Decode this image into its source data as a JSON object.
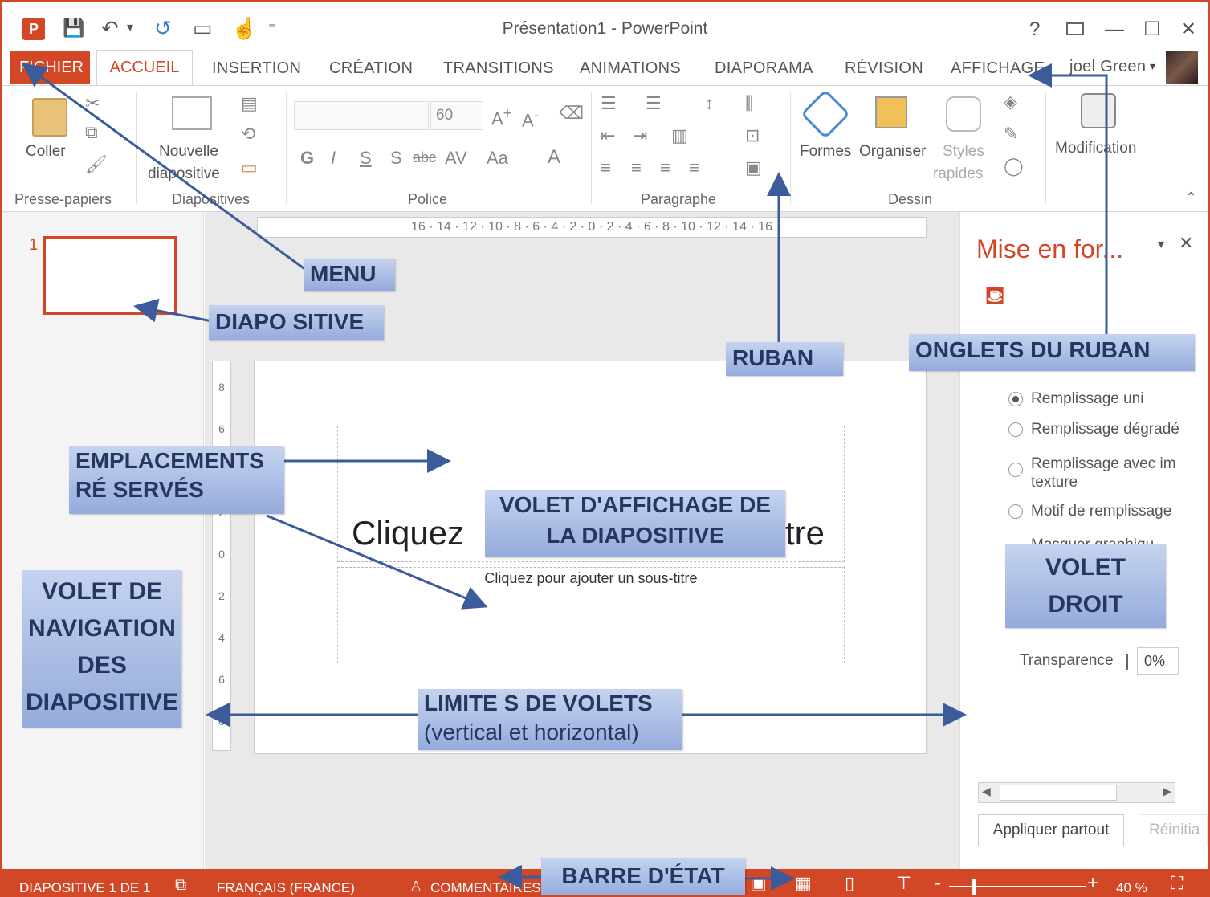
{
  "window": {
    "title": "Présentation1 - PowerPoint",
    "user": "joel Green",
    "help": "?",
    "restore_icon": "ribbon-display-icon",
    "min": "—",
    "max": "☐",
    "close": "✕"
  },
  "qat": {
    "app_icon": "P",
    "save": "💾",
    "undo": "↶",
    "undo_arrow": "▾",
    "redo": "↺",
    "start": "▭",
    "touch": "☝",
    "more": "⁼"
  },
  "tabs": {
    "file": "FICHIER",
    "home": "ACCUEIL",
    "insert": "INSERTION",
    "design": "CRÉATION",
    "transitions": "TRANSITIONS",
    "animations": "ANIMATIONS",
    "slideshow": "DIAPORAMA",
    "review": "RÉVISION",
    "view": "AFFICHAGE"
  },
  "ribbon": {
    "paste": "Coller",
    "new_slide_1": "Nouvelle",
    "new_slide_2": "diapositive",
    "font_size": "60",
    "shapes": "Formes",
    "arrange": "Organiser",
    "styles_1": "Styles",
    "styles_2": "rapides",
    "editing": "Modification",
    "groups": {
      "clipboard": "Presse-papiers",
      "slides": "Diapositives",
      "font": "Police",
      "paragraph": "Paragraphe",
      "drawing": "Dessin"
    },
    "font_buttons": [
      "G",
      "I",
      "S",
      "S",
      "abc",
      "AV",
      "Aa",
      "A"
    ]
  },
  "ruler": "16 · 14 · 12 · 10 · 8 · 6 · 4 · 2 · 0 · 2 · 4 · 6 · 8 · 10 · 12 · 14 · 16",
  "vruler": [
    "8",
    "6",
    "4",
    "2",
    "0",
    "2",
    "4",
    "6",
    "8"
  ],
  "nav": {
    "slide_number": "1"
  },
  "slide": {
    "title_placeholder": "Cliquez pour ajouter un titre",
    "title_visible_left": "Cliquez",
    "title_visible_right": "tre",
    "subtitle_placeholder": "Cliquez pour ajouter un sous-titre"
  },
  "right_pane": {
    "title": "Mise en for...",
    "options": [
      {
        "label": "Remplissage uni",
        "selected": true
      },
      {
        "label": "Remplissage dégradé",
        "selected": false
      },
      {
        "label": "Remplissage avec im texture",
        "selected": false
      },
      {
        "label": "Motif de remplissage",
        "selected": false
      }
    ],
    "option3_line1": "Remplissage avec im",
    "option3_line2": "texture",
    "partial": "Masquer graphiqu",
    "transparency_label": "Transparence",
    "transparency_value": "0%",
    "apply_all": "Appliquer partout",
    "reset": "Réinitia"
  },
  "status": {
    "slide": "DIAPOSITIVE 1 DE 1",
    "language": "FRANÇAIS (FRANCE)",
    "comments": "COMMENTAIRES",
    "zoom": "40 %",
    "minus": "-",
    "plus": "+"
  },
  "callouts": {
    "menu": "MENU",
    "diapositive": "DIAPO SITIVE",
    "ruban": "RUBAN",
    "onglets": "ONGLETS DU RUBAN",
    "emplacements_1": "EMPLACEMENTS",
    "emplacements_2": "RÉ SERVÉS",
    "volet_affichage_1": "VOLET D'AFFICHAGE DE",
    "volet_affichage_2": "LA DIAPOSITIVE",
    "volet_nav_1": "VOLET DE",
    "volet_nav_2": "NAVIGATION",
    "volet_nav_3": "DES",
    "volet_nav_4": "DIAPOSITIVE",
    "volet_droit_1": "VOLET",
    "volet_droit_2": "DROIT",
    "limites_1": "LIMITE S DE VOLETS",
    "limites_2": "(vertical et horizontal)",
    "barre": "BARRE D'ÉTAT"
  },
  "colors": {
    "accent": "#d24726",
    "callout": "#a9bde6",
    "arrow": "#3b5b9a"
  }
}
